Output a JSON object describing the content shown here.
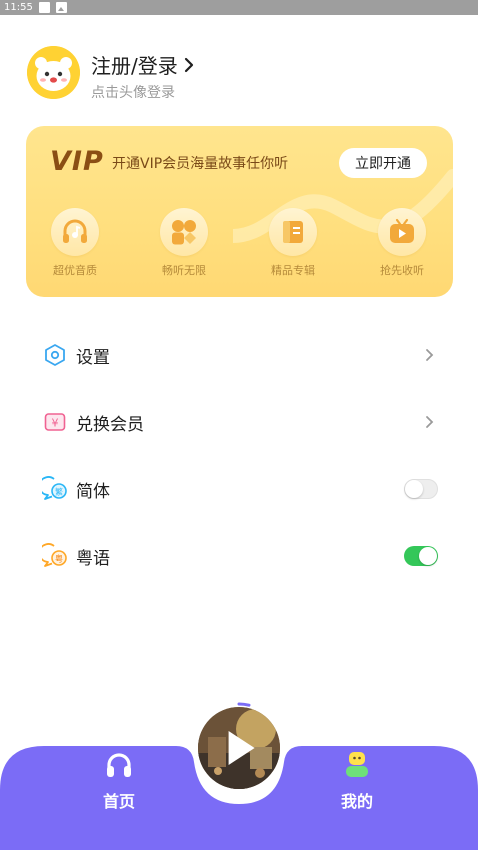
{
  "status_bar": {
    "time": "11:55"
  },
  "profile": {
    "title": "注册/登录",
    "subtitle": "点击头像登录"
  },
  "vip": {
    "logo": "VIP",
    "description": "开通VIP会员海量故事任你听",
    "button": "立即开通",
    "perks": [
      {
        "label": "超优音质",
        "icon": "headphones-icon"
      },
      {
        "label": "畅听无限",
        "icon": "grid-icon"
      },
      {
        "label": "精品专辑",
        "icon": "album-icon"
      },
      {
        "label": "抢先收听",
        "icon": "tv-play-icon"
      }
    ]
  },
  "menu": {
    "settings": {
      "label": "设置",
      "icon": "settings-icon"
    },
    "redeem": {
      "label": "兑换会员",
      "icon": "yen-coupon-icon"
    },
    "simplified": {
      "label": "简体",
      "icon": "simplified-chat-icon",
      "enabled": false
    },
    "cantonese": {
      "label": "粤语",
      "icon": "cantonese-chat-icon",
      "enabled": true
    }
  },
  "bottom_nav": {
    "home": "首页",
    "mine": "我的",
    "accent": "#7b6cf6"
  },
  "player": {
    "icon": "play-icon"
  }
}
